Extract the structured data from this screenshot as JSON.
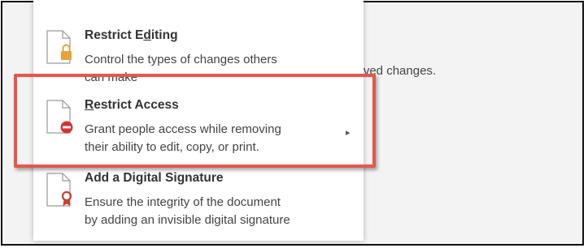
{
  "background": {
    "partial_text": "saved changes."
  },
  "menu": {
    "items": [
      {
        "title_pre": "Restrict E",
        "title_underlined": "d",
        "title_post": "iting",
        "desc_lines": [
          "Control the types of changes others",
          "can make"
        ],
        "icon": "lock-icon",
        "has_submenu": false
      },
      {
        "title_pre": "",
        "title_underlined": "R",
        "title_post": "estrict Access",
        "desc_lines": [
          "Grant people access while removing",
          "their ability to edit, copy, or print."
        ],
        "icon": "restrict-minus-icon",
        "has_submenu": true
      },
      {
        "title_pre": "Add a Digital ",
        "title_underlined": "",
        "title_post": "Signature",
        "desc_lines": [
          "Ensure the integrity of the document",
          "by adding an invisible digital signature"
        ],
        "icon": "ribbon-badge-icon",
        "has_submenu": false
      }
    ]
  },
  "colors": {
    "highlight": "#e4584d",
    "lock": "#e8a33d",
    "restrict": "#d13438",
    "ribbon": "#c8402f"
  }
}
